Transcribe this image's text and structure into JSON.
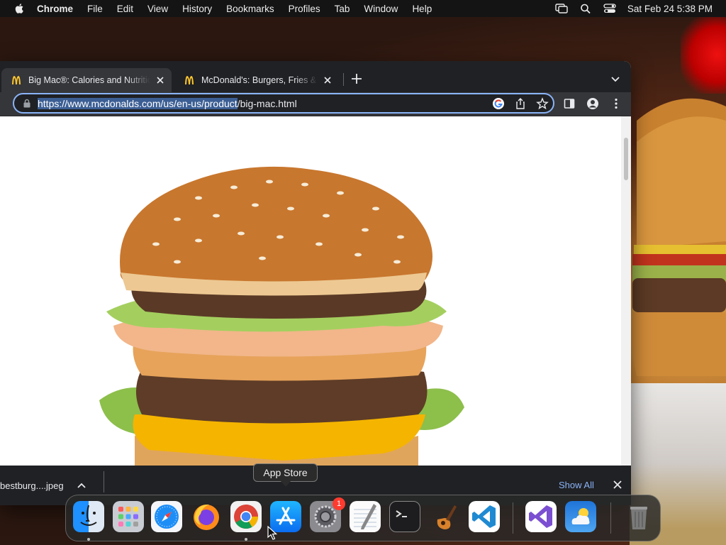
{
  "menubar": {
    "apple_icon": "apple-icon",
    "app_name": "Chrome",
    "items": [
      "File",
      "Edit",
      "View",
      "History",
      "Bookmarks",
      "Profiles",
      "Tab",
      "Window",
      "Help"
    ],
    "right_icons": [
      "screen-mirroring-icon",
      "spotlight-search-icon",
      "control-center-icon"
    ],
    "clock": "Sat Feb 24  5:38 PM"
  },
  "browser": {
    "tabs": [
      {
        "title": "Big Mac®: Calories and Nutrition",
        "favicon": "mcdonalds-logo-icon",
        "active": true
      },
      {
        "title": "McDonald's: Burgers, Fries & More",
        "favicon": "mcdonalds-logo-icon",
        "active": false
      }
    ],
    "address": {
      "url_selected": "https://www.mcdonalds.com/us/en-us/product",
      "url_rest": "/big-mac.html"
    },
    "colors": {
      "focus_ring": "#8ab4f8",
      "selection": "#3b5e94",
      "tab_bg": "#202124",
      "active_tab": "#35363a"
    }
  },
  "downloads": {
    "file_name": "bestburg....jpeg",
    "show_all": "Show All"
  },
  "tooltip": "App Store",
  "dock": {
    "apps": [
      {
        "name": "Finder",
        "running": true
      },
      {
        "name": "Launchpad",
        "running": false
      },
      {
        "name": "Safari",
        "running": false
      },
      {
        "name": "Firefox",
        "running": false
      },
      {
        "name": "Google Chrome",
        "running": true
      },
      {
        "name": "App Store",
        "running": false
      },
      {
        "name": "System Settings",
        "running": false,
        "badge": "1"
      },
      {
        "name": "TextEdit",
        "running": false
      },
      {
        "name": "Terminal",
        "running": false
      },
      {
        "name": "GarageBand",
        "running": false
      },
      {
        "name": "Visual Studio Code",
        "running": false
      },
      {
        "name": "Visual Studio",
        "running": false
      },
      {
        "name": "Weather",
        "running": false
      },
      {
        "name": "Trash",
        "running": false
      }
    ]
  }
}
